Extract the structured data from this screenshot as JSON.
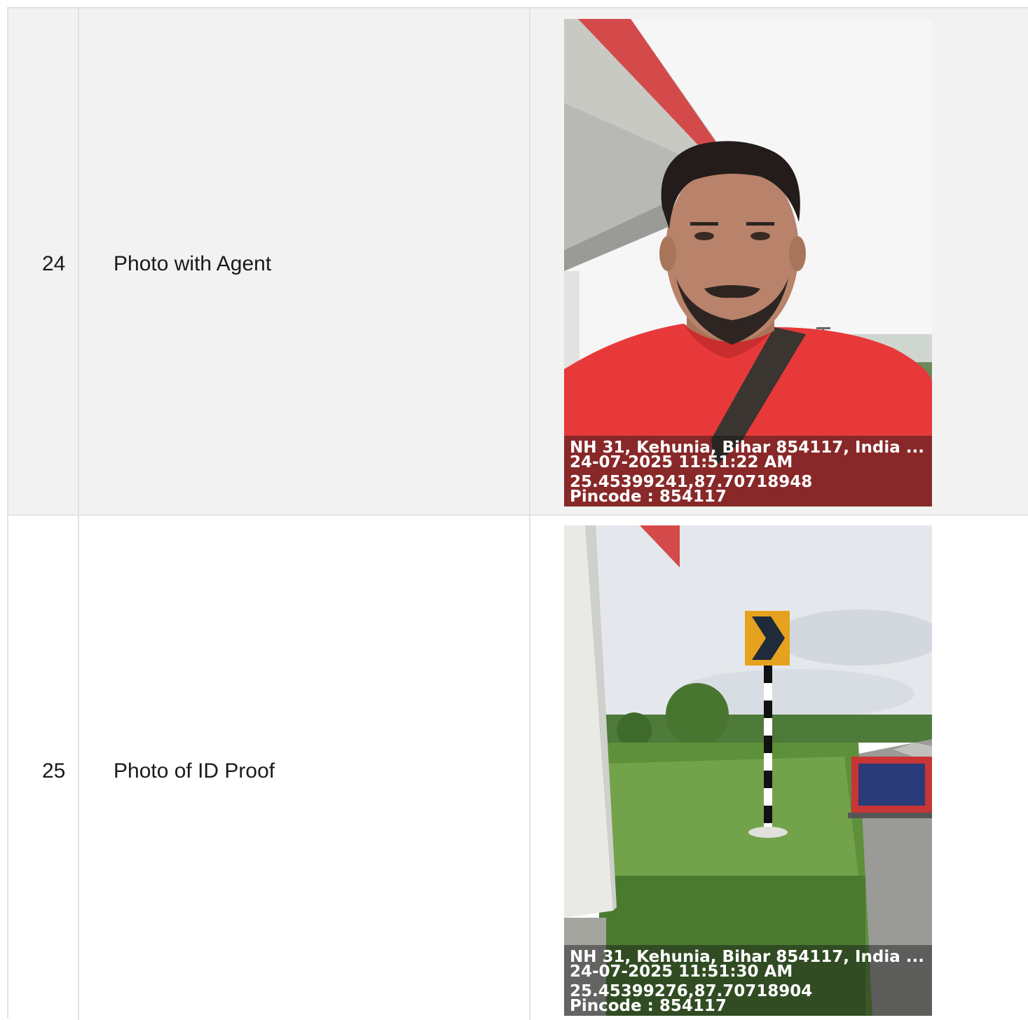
{
  "rows": [
    {
      "number": "24",
      "label": "Photo with Agent",
      "stamp": {
        "address": "NH 31, Kehunia, Bihar 854117, India ...",
        "datetime": "24-07-2025 11:51:22 AM",
        "coords": "25.45399241,87.70718948",
        "pincode": "Pincode : 854117"
      }
    },
    {
      "number": "25",
      "label": "Photo of ID Proof",
      "stamp": {
        "address": "NH 31, Kehunia, Bihar 854117, India ...",
        "datetime": "24-07-2025 11:51:30 AM",
        "coords": "25.45399276,87.70718904",
        "pincode": "Pincode : 854117"
      }
    }
  ],
  "colors": {
    "row_odd": "#f2f2f2",
    "row_even": "#ffffff",
    "border": "#e2e2e2",
    "shirt": "#e8393a"
  }
}
